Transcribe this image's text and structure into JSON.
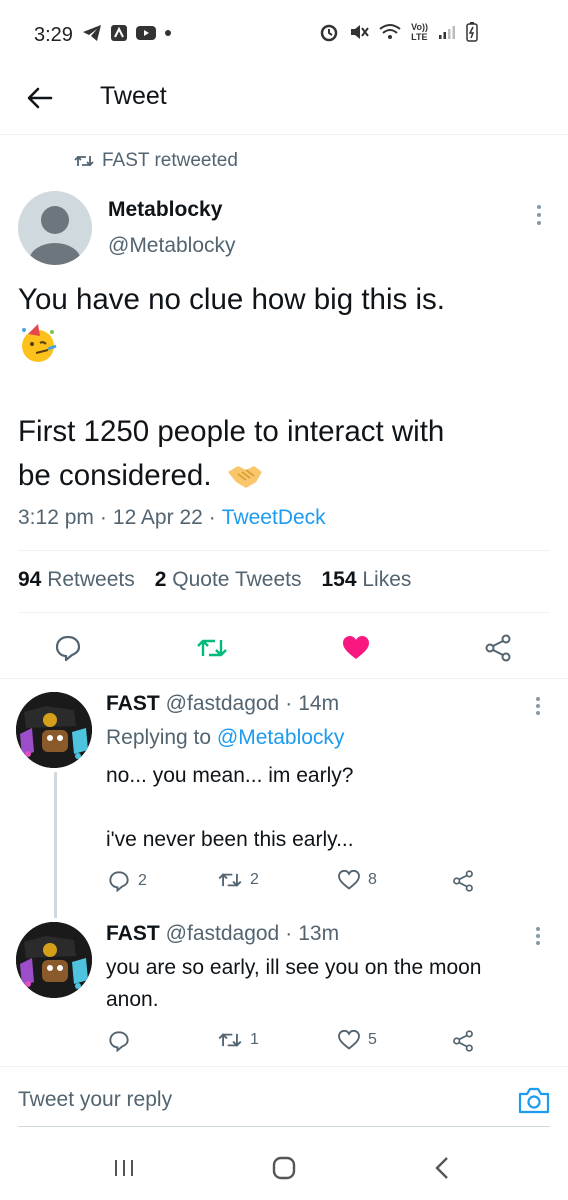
{
  "status_bar": {
    "time": "3:29",
    "lte_top": "Vo))",
    "lte_bottom": "LTE"
  },
  "header": {
    "title": "Tweet"
  },
  "tweet": {
    "retweet_context": "FAST retweeted",
    "author_name": "Metablocky",
    "author_handle": "@Metablocky",
    "text_line1": "You have no clue how big this is.",
    "text_line2": "First 1250 people to interact with",
    "text_line3": "be considered.",
    "time": "3:12 pm",
    "date": "12 Apr 22",
    "source": "TweetDeck",
    "stats": {
      "retweets_count": "94",
      "retweets_label": "Retweets",
      "quotes_count": "2",
      "quotes_label": "Quote Tweets",
      "likes_count": "154",
      "likes_label": "Likes"
    }
  },
  "replies": [
    {
      "name": "FAST",
      "handle": "@fastdagod",
      "sep": "·",
      "time": "14m",
      "replying_prefix": "Replying to",
      "replying_to": "@Metablocky",
      "line1": "no... you mean... im early?",
      "line2": "i've never been this early...",
      "reply_count": "2",
      "retweet_count": "2",
      "like_count": "8"
    },
    {
      "name": "FAST",
      "handle": "@fastdagod",
      "sep": "·",
      "time": "13m",
      "line1": "you are so early, ill see you on the moon",
      "line2": "anon.",
      "retweet_count": "1",
      "like_count": "5"
    }
  ],
  "reply_box": {
    "placeholder": "Tweet your reply"
  },
  "colors": {
    "accent": "#1d9bf0",
    "retweet_green": "#00ba7c",
    "like_pink": "#f91880",
    "muted": "#536471"
  }
}
